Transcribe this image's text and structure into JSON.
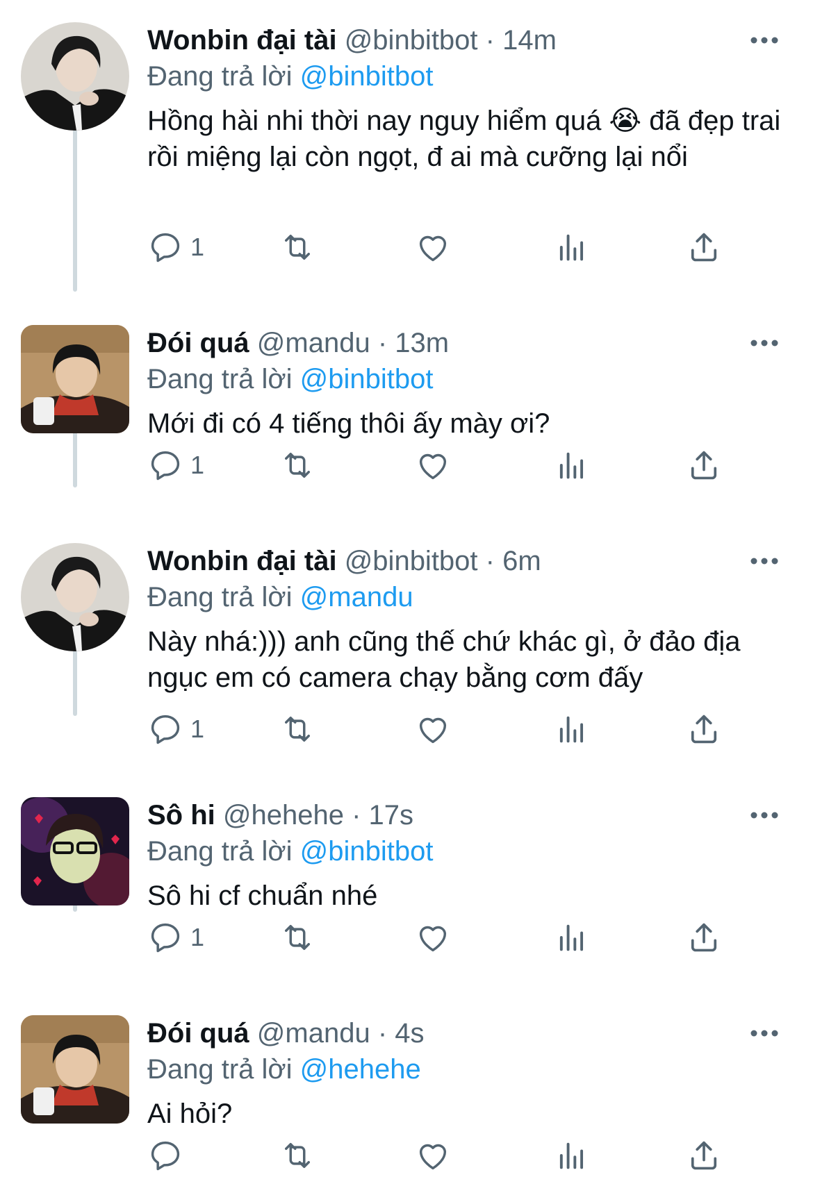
{
  "replying_prefix": "Đang trả lời",
  "tweets": [
    {
      "name": "Wonbin đại tài",
      "handle": "@binbitbot",
      "time": "14m",
      "meta": "@binbitbot · 14m",
      "reply_to": "@binbitbot",
      "text": "Hồng hài nhi thời nay nguy hiểm quá 😭  đã đẹp trai rồi miệng lại còn ngọt, đ ai mà cưỡng lại nổi",
      "reply_count": "1"
    },
    {
      "name": "Đói quá",
      "handle": "@mandu",
      "time": "13m",
      "meta": "@mandu · 13m",
      "reply_to": "@binbitbot",
      "text": "Mới đi có 4 tiếng thôi ấy mày ơi?",
      "reply_count": "1"
    },
    {
      "name": "Wonbin đại tài",
      "handle": "@binbitbot",
      "time": "6m",
      "meta": "@binbitbot · 6m",
      "reply_to": "@mandu",
      "text": "Này nhá:))) anh cũng thế chứ khác gì, ở đảo địa ngục em có camera chạy bằng cơm đấy",
      "reply_count": "1"
    },
    {
      "name": "Sô hi",
      "handle": "@hehehe",
      "time": "17s",
      "meta": "@hehehe · 17s",
      "reply_to": "@binbitbot",
      "text": "Sô hi cf chuẩn nhé",
      "reply_count": "1"
    },
    {
      "name": "Đói quá",
      "handle": "@mandu",
      "time": "4s",
      "meta": "@mandu · 4s",
      "reply_to": "@hehehe",
      "text": "Ai hỏi?",
      "reply_count": ""
    }
  ],
  "icons": {
    "reply": "reply-icon",
    "retweet": "retweet-icon",
    "like": "heart-icon",
    "views": "views-icon",
    "share": "share-icon",
    "more": "more-icon"
  },
  "colors": {
    "mention": "#1d9bf0",
    "secondary_text": "#536471",
    "thread_line": "#cfd9de"
  }
}
